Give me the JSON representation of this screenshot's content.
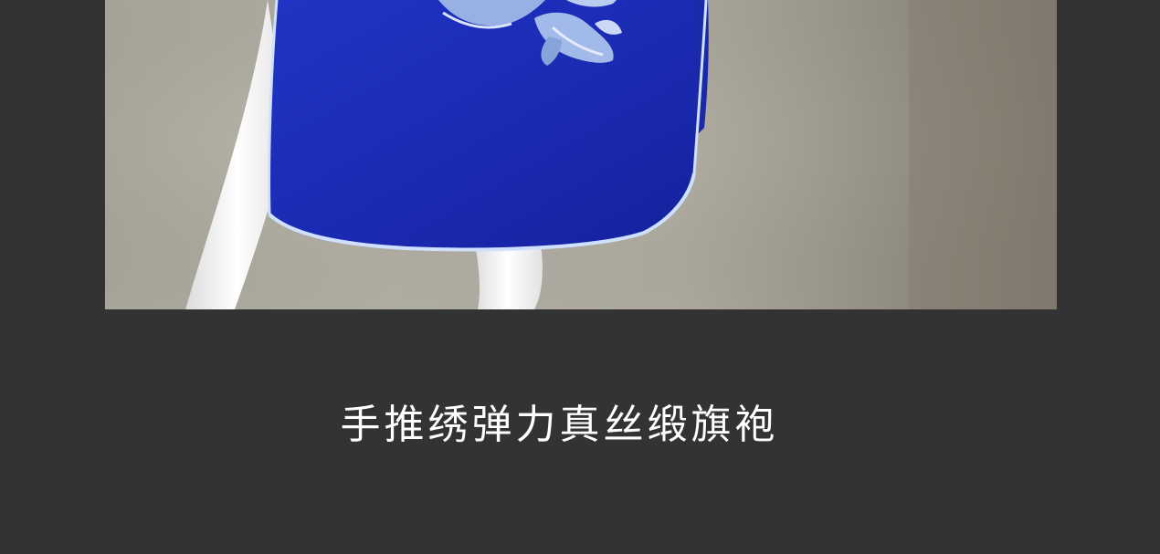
{
  "product_image": {
    "subject": "blue-silk-qipao-on-mannequin",
    "colors": {
      "background": "#333333",
      "fabric": "#1f2bb8",
      "trim": "#cfe0ff",
      "mannequin": "#f2f2f2"
    }
  },
  "caption": {
    "text": "手推绣弹力真丝缎旗袍"
  }
}
